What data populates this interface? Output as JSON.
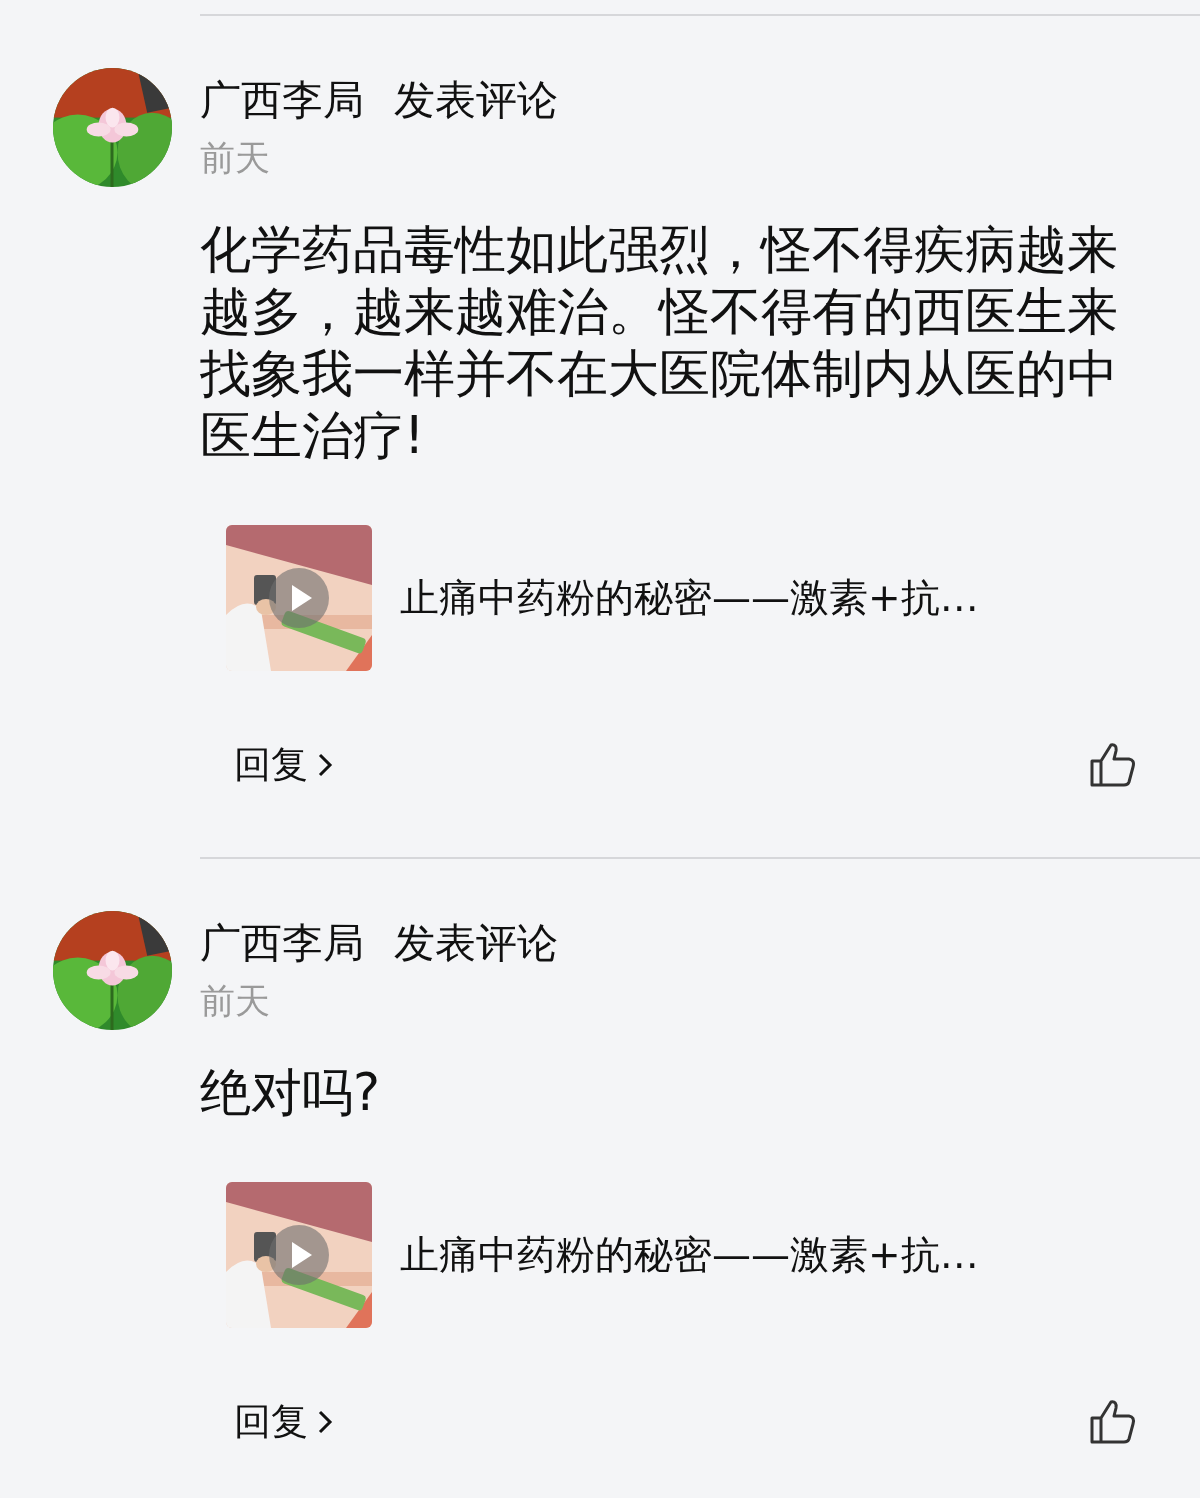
{
  "comments": [
    {
      "author": "广西李局",
      "action": "发表评论",
      "time": "前天",
      "text": "化学药品毒性如此强烈，怪不得疾病越来越多，越来越难治。怪不得有的西医生来找象我一样并不在大医院体制内从医的中医生治疗!",
      "video": {
        "title": "止痛中药粉的秘密——激素+抗…"
      },
      "reply": "回复"
    },
    {
      "author": "广西李局",
      "action": "发表评论",
      "time": "前天",
      "text": "绝对吗?",
      "video": {
        "title": "止痛中药粉的秘密——激素+抗…"
      },
      "reply": "回复"
    }
  ]
}
